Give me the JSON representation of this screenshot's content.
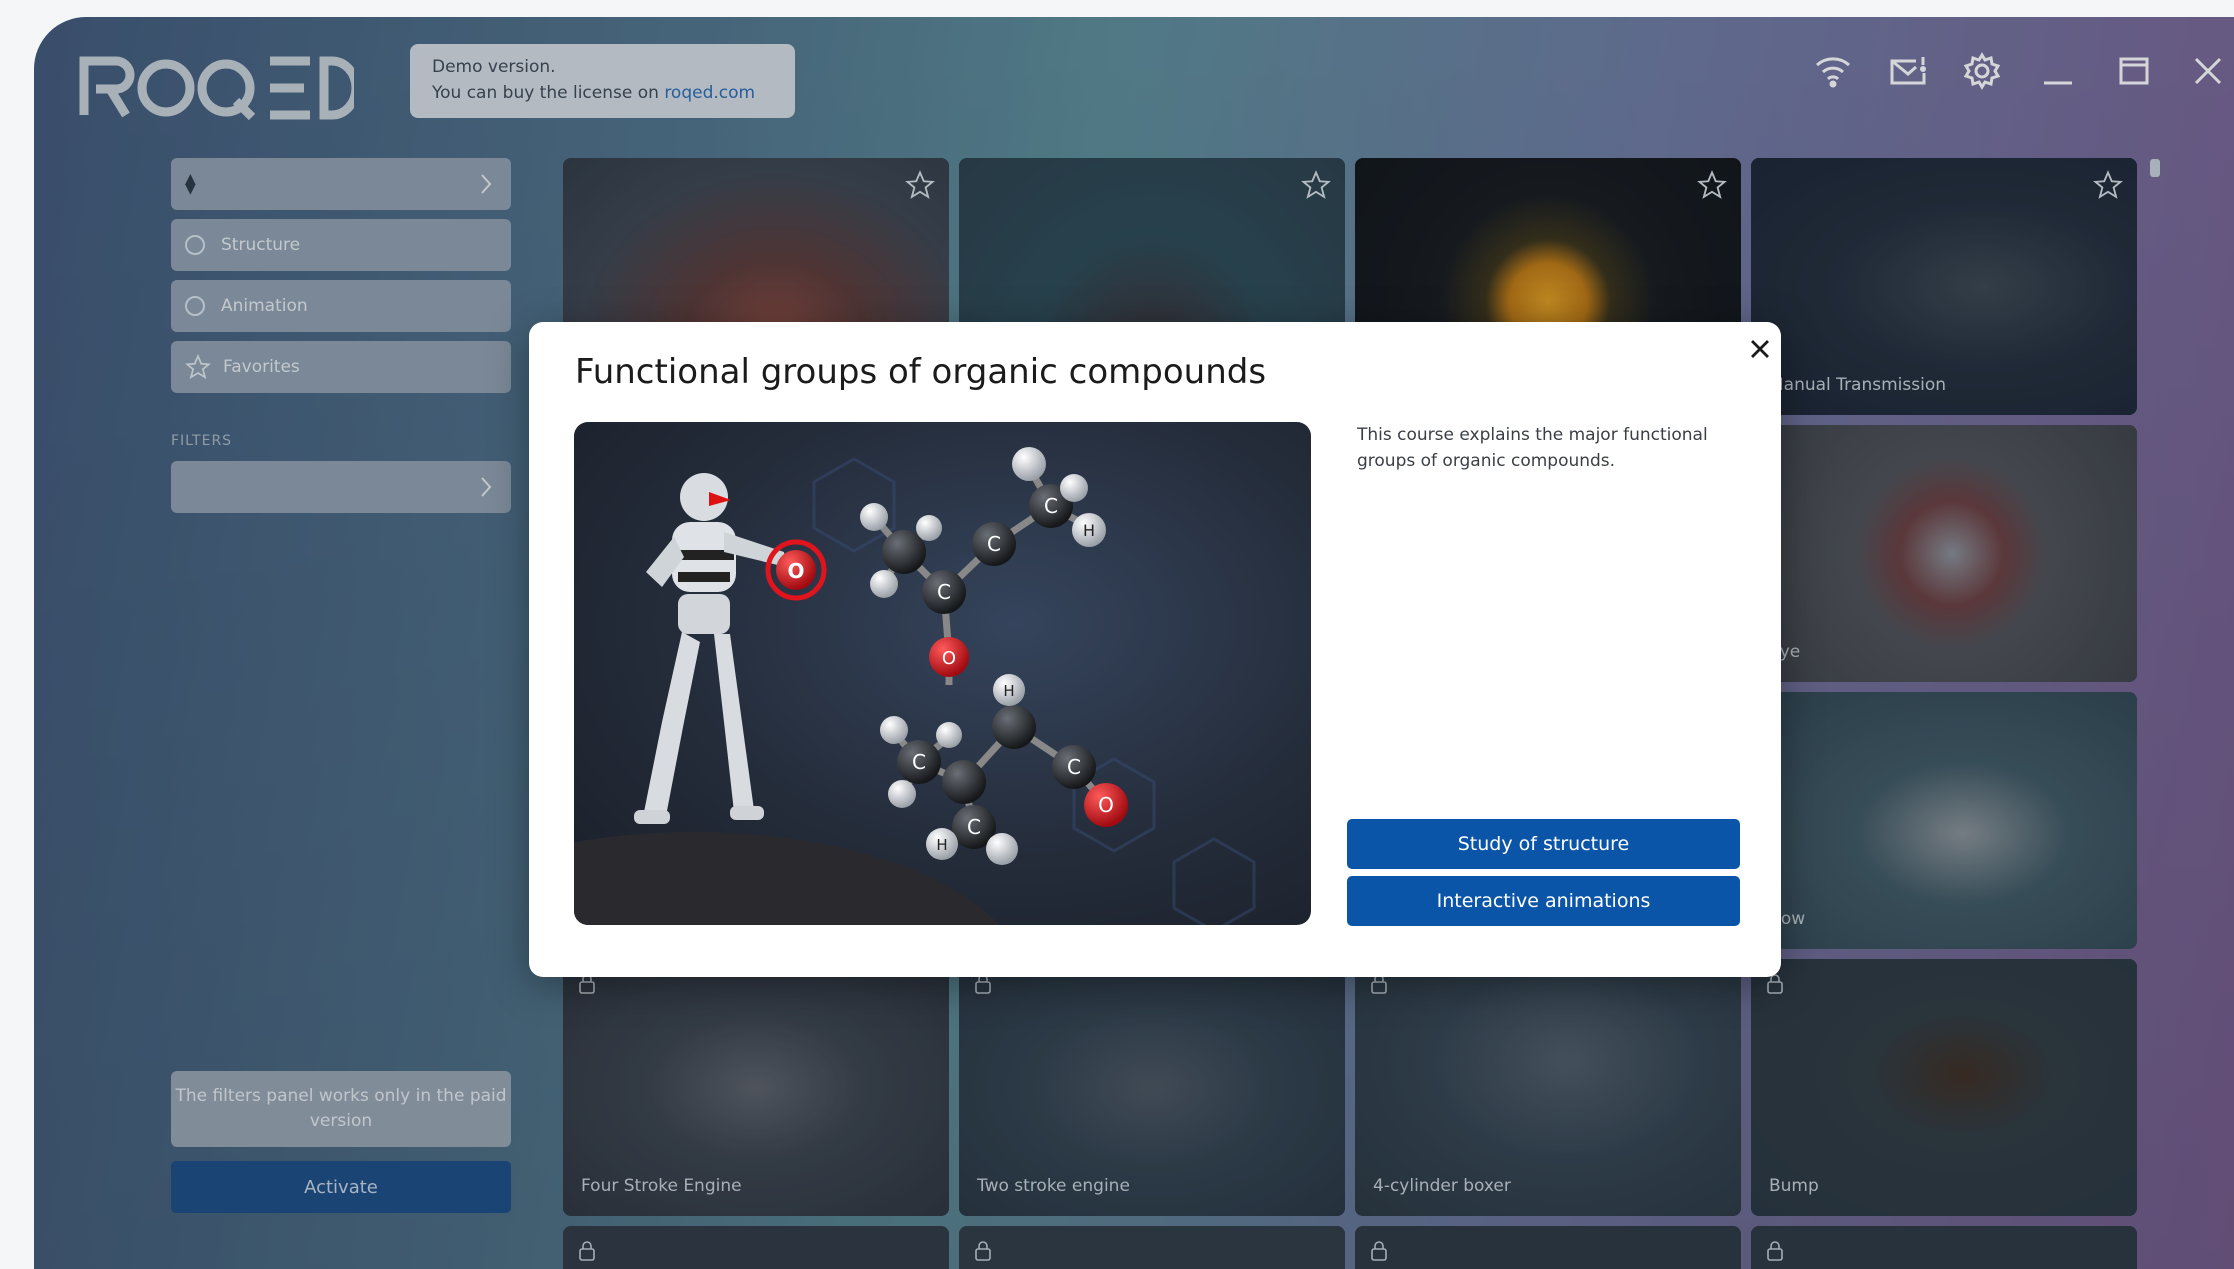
{
  "app": {
    "logo_text": "ROQED",
    "demo_notice": {
      "line1": "Demo version.",
      "line2_prefix": "You can buy the license on ",
      "link": "roqed.com"
    }
  },
  "window_controls": [
    "wifi-icon",
    "mail-icon",
    "gear-icon",
    "minimize-icon",
    "maximize-icon",
    "close-icon"
  ],
  "sidebar": {
    "sort_button": "",
    "items": [
      {
        "label": "Structure",
        "icon": "radio-icon"
      },
      {
        "label": "Animation",
        "icon": "radio-icon"
      },
      {
        "label": "Favorites",
        "icon": "star-icon"
      }
    ],
    "filters_label": "FILTERS",
    "filter_select": "",
    "note": "The filters panel works only in the paid version",
    "activate_label": "Activate"
  },
  "cards": [
    {
      "label": ""
    },
    {
      "label": ""
    },
    {
      "label": ""
    },
    {
      "label": "Manual Transmission"
    },
    {
      "label": "Eye"
    },
    {
      "label": "Cow"
    },
    {
      "label": "Four Stroke Engine"
    },
    {
      "label": "Two stroke engine"
    },
    {
      "label": "4-cylinder boxer"
    },
    {
      "label": "Bump"
    }
  ],
  "modal": {
    "title": "Functional groups of organic compounds",
    "description": "This course explains the major functional groups of organic compounds.",
    "btn_structure": "Study of structure",
    "btn_animations": "Interactive animations",
    "atoms": {
      "c": "C",
      "h": "H",
      "o": "O"
    }
  },
  "colors": {
    "accent": "#0b55a9",
    "activate": "#1b4d86",
    "oxygen": "#d0121b"
  }
}
